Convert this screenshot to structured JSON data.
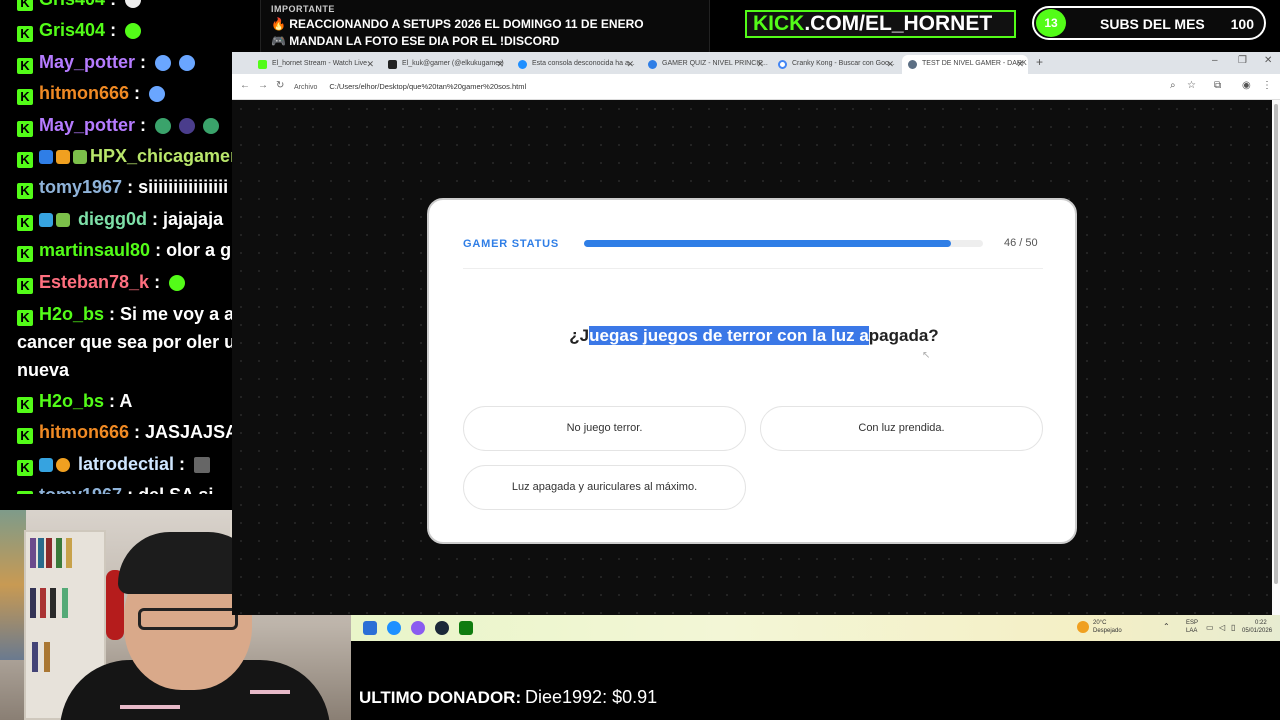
{
  "chat": {
    "messages": [
      {
        "user": "Gris404",
        "text": "",
        "color": "#53fc18"
      },
      {
        "user": "Gris404",
        "text": "",
        "color": "#53fc18"
      },
      {
        "user": "May_potter",
        "text": "",
        "color": "#b57bff"
      },
      {
        "user": "hitmon666",
        "text": "",
        "color": "#f08a24"
      },
      {
        "user": "May_potter",
        "text": "",
        "color": "#b57bff"
      },
      {
        "user": "HPX_chicagamer",
        "text": "",
        "color": "#b9e66b"
      },
      {
        "user": "tomy1967",
        "text": "siiiiiiiiiiiiiiii",
        "color": "#8fb3d9"
      },
      {
        "user": "diegg0d",
        "text": "jajajaja",
        "color": "#7ee0a8"
      },
      {
        "user": "martinsaul80",
        "text": "olor a guita",
        "color": "#53fc18"
      },
      {
        "user": "Esteban78_k",
        "text": "",
        "color": "#ff6f7f"
      },
      {
        "user": "H2o_bs",
        "text": "Si me voy a agarrar cancer que sea por oler una placa nueva",
        "color": "#53fc18"
      },
      {
        "user": "H2o_bs",
        "text": "A",
        "color": "#53fc18"
      },
      {
        "user": "hitmon666",
        "text": "JASJAJSAJKA",
        "color": "#f08a24"
      },
      {
        "user": "latrodectial",
        "text": "",
        "color": "#cfe6ff"
      },
      {
        "user": "tomy1967",
        "text": "del SA si",
        "color": "#8fb3d9"
      }
    ]
  },
  "notice": {
    "title": "IMPORTANTE",
    "line1": "🔥 REACCIONANDO A SETUPS 2026 EL DOMINGO 11 DE ENERO",
    "line2": "🎮 MANDAN LA FOTO ESE DIA POR EL !DISCORD"
  },
  "banner": {
    "kick": "KICK",
    "rest": ".COM/EL_HORNET"
  },
  "subs": {
    "count": "13",
    "label": "SUBS DEL MES",
    "goal": "100"
  },
  "browser": {
    "tabs": [
      {
        "label": "El_hornet Stream - Watch Live",
        "color": "#53fc18"
      },
      {
        "label": "El_kuk@gamer (@elkukugamer)",
        "color": "#222"
      },
      {
        "label": "Esta consola desconocida ha a...",
        "color": "#1f8fff"
      },
      {
        "label": "GAMER QUIZ - NIVEL PRINCIP...",
        "color": "#2f7ee6"
      },
      {
        "label": "Cranky Kong - Buscar con Goo...",
        "color": "#4285f4"
      },
      {
        "label": "TEST DE NIVEL GAMER - DARK",
        "color": "#5c6f84"
      }
    ],
    "url_label": "Archivo",
    "url": "C:/Users/elhor/Desktop/que%20tan%20gamer%20sos.html"
  },
  "quiz": {
    "status_label": "GAMER STATUS",
    "progress_text": "46 / 50",
    "progress": 0.92,
    "question_pre": "¿J",
    "question_hl": "uegas juegos de terror con la luz a",
    "question_post": "pagada?",
    "options": [
      "No juego terror.",
      "Con luz prendida.",
      "Luz apagada y auriculares al máximo."
    ]
  },
  "tray": {
    "temp": "20°C",
    "weather": "Despejado",
    "lang1": "ESP",
    "lang2": "LAA",
    "time": "0:22",
    "date": "05/01/2026"
  },
  "donor": {
    "label": "ULTIMO DONADOR:",
    "value": "Diee1992: $0.91"
  }
}
